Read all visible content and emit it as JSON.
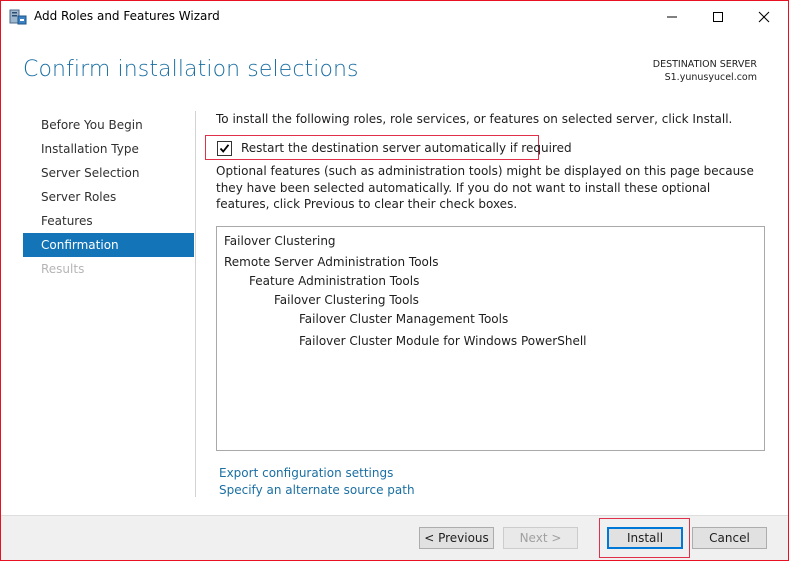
{
  "window": {
    "title": "Add Roles and Features Wizard"
  },
  "header": {
    "page_title": "Confirm installation selections",
    "destination_label": "DESTINATION SERVER",
    "destination_server": "S1.yunusyucel.com"
  },
  "nav": {
    "items": [
      {
        "label": "Before You Begin",
        "state": "normal"
      },
      {
        "label": "Installation Type",
        "state": "normal"
      },
      {
        "label": "Server Selection",
        "state": "normal"
      },
      {
        "label": "Server Roles",
        "state": "normal"
      },
      {
        "label": "Features",
        "state": "normal"
      },
      {
        "label": "Confirmation",
        "state": "active"
      },
      {
        "label": "Results",
        "state": "disabled"
      }
    ]
  },
  "content": {
    "intro": "To install the following roles, role services, or features on selected server, click Install.",
    "restart_checkbox": {
      "label": "Restart the destination server automatically if required",
      "checked": true
    },
    "optional_text": "Optional features (such as administration tools) might be displayed on this page because they have been selected automatically. If you do not want to install these optional features, click Previous to clear their check boxes.",
    "features": [
      {
        "label": "Failover Clustering",
        "level": 0
      },
      {
        "label": "Remote Server Administration Tools",
        "level": 0
      },
      {
        "label": "Feature Administration Tools",
        "level": 1
      },
      {
        "label": "Failover Clustering Tools",
        "level": 2
      },
      {
        "label": "Failover Cluster Management Tools",
        "level": 3
      },
      {
        "label": "Failover Cluster Module for Windows PowerShell",
        "level": 3
      }
    ],
    "export_link": "Export configuration settings",
    "alt_source_link": "Specify an alternate source path"
  },
  "buttons": {
    "previous": "< Previous",
    "next": "Next >",
    "install": "Install",
    "cancel": "Cancel"
  },
  "colors": {
    "accent": "#1474b8",
    "title": "#1b6fa3",
    "highlight": "#e0314b"
  }
}
